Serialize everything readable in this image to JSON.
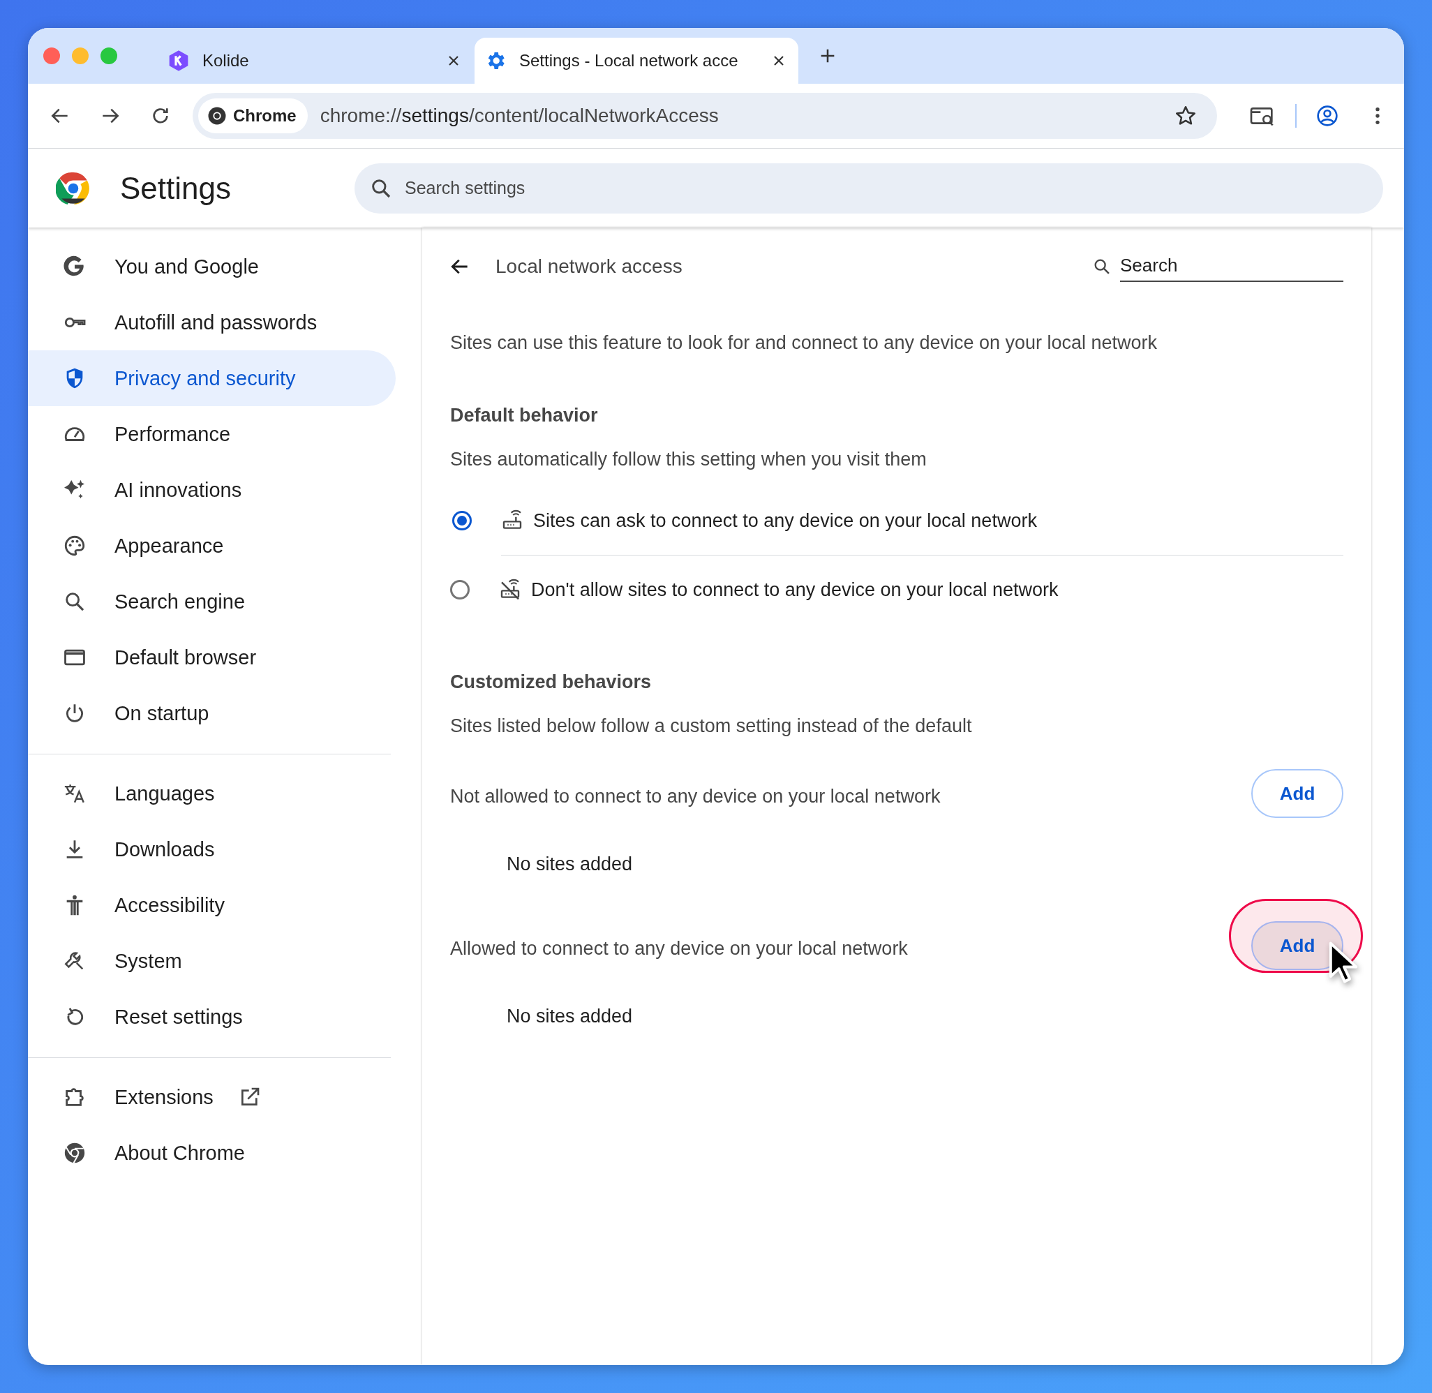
{
  "tabs": [
    {
      "title": "Kolide",
      "selected": false
    },
    {
      "title": "Settings - Local network acce",
      "selected": true
    }
  ],
  "address": {
    "chip": "Chrome",
    "scheme": "chrome://",
    "host": "settings",
    "path": "/content/localNetworkAccess"
  },
  "header": {
    "title": "Settings",
    "search_placeholder": "Search settings"
  },
  "sidebar": {
    "sections": [
      [
        {
          "label": "You and Google",
          "selected": false
        },
        {
          "label": "Autofill and passwords",
          "selected": false
        },
        {
          "label": "Privacy and security",
          "selected": true
        },
        {
          "label": "Performance",
          "selected": false
        },
        {
          "label": "AI innovations",
          "selected": false
        },
        {
          "label": "Appearance",
          "selected": false
        },
        {
          "label": "Search engine",
          "selected": false
        },
        {
          "label": "Default browser",
          "selected": false
        },
        {
          "label": "On startup",
          "selected": false
        }
      ],
      [
        {
          "label": "Languages",
          "selected": false
        },
        {
          "label": "Downloads",
          "selected": false
        },
        {
          "label": "Accessibility",
          "selected": false
        },
        {
          "label": "System",
          "selected": false
        },
        {
          "label": "Reset settings",
          "selected": false
        }
      ],
      [
        {
          "label": "Extensions",
          "selected": false,
          "external_link": true
        },
        {
          "label": "About Chrome",
          "selected": false
        }
      ]
    ]
  },
  "page": {
    "title": "Local network access",
    "search_placeholder": "Search",
    "description": "Sites can use this feature to look for and connect to any device on your local network",
    "default_behavior": {
      "heading": "Default behavior",
      "subtitle": "Sites automatically follow this setting when you visit them",
      "options": [
        {
          "label": "Sites can ask to connect to any device on your local network",
          "selected": true
        },
        {
          "label": "Don't allow sites to connect to any device on your local network",
          "selected": false
        }
      ]
    },
    "customized_behaviors": {
      "heading": "Customized behaviors",
      "subtitle": "Sites listed below follow a custom setting instead of the default",
      "lists": [
        {
          "label": "Not allowed to connect to any device on your local network",
          "button": "Add",
          "empty": "No sites added",
          "highlighted": false
        },
        {
          "label": "Allowed to connect to any device on your local network",
          "button": "Add",
          "empty": "No sites added",
          "highlighted": true
        }
      ]
    }
  }
}
